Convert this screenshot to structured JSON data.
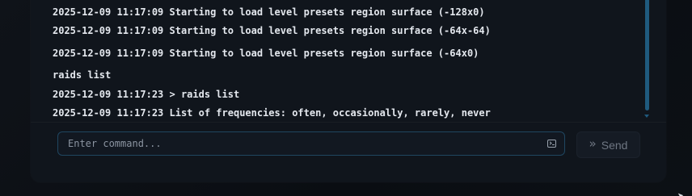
{
  "console": {
    "lines": [
      "2025-12-09 11:17:09 Starting to load level presets region surface (-128x0)",
      "2025-12-09 11:17:09 Starting to load level presets region surface (-64x-64)",
      "2025-12-09 11:17:09 Starting to load level presets region surface (-64x0)",
      "raids list",
      "2025-12-09 11:17:23 > raids list",
      "2025-12-09 11:17:23 List of frequencies: often, occasionally, rarely, never"
    ]
  },
  "command": {
    "placeholder": "Enter command...",
    "value": "",
    "input_icon": "terminal-icon"
  },
  "send_button": {
    "label": "Send",
    "icon": "double-chevron-right-icon"
  },
  "colors": {
    "background": "#0b0e13",
    "panel": "#10151c",
    "accent": "#1f5a7e",
    "text": "#e4e8ee",
    "muted": "#6e7682"
  }
}
